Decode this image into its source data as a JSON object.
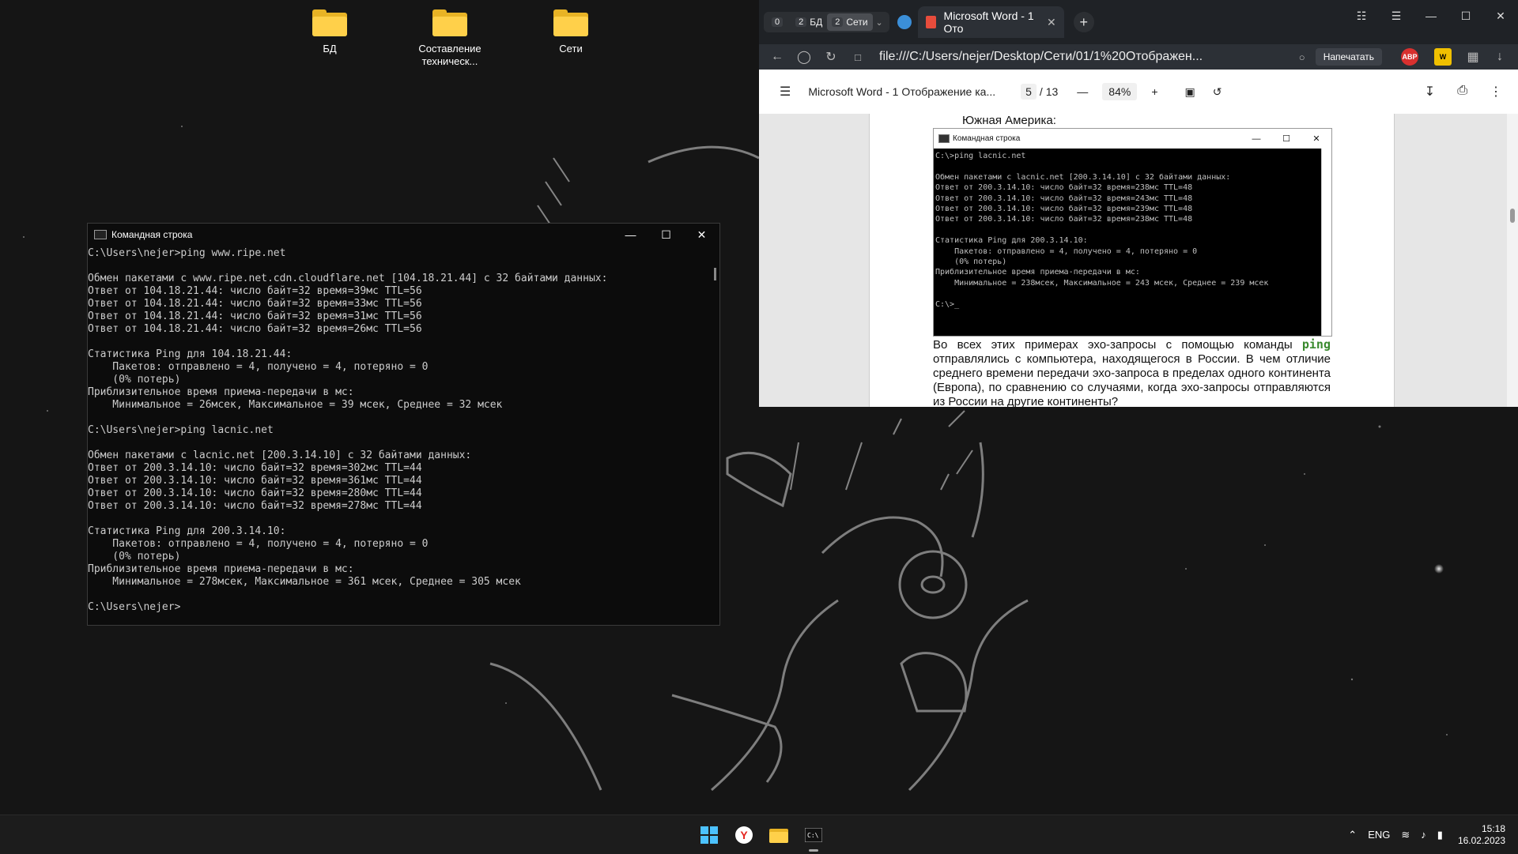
{
  "desktop": {
    "icons": [
      {
        "label": "БД"
      },
      {
        "label": "Составление техническ..."
      },
      {
        "label": "Сети"
      }
    ]
  },
  "cmd_window": {
    "title": "Командная строка",
    "lines": [
      "C:\\Users\\nejer>ping www.ripe.net",
      "",
      "Обмен пакетами с www.ripe.net.cdn.cloudflare.net [104.18.21.44] с 32 байтами данных:",
      "Ответ от 104.18.21.44: число байт=32 время=39мс TTL=56",
      "Ответ от 104.18.21.44: число байт=32 время=33мс TTL=56",
      "Ответ от 104.18.21.44: число байт=32 время=31мс TTL=56",
      "Ответ от 104.18.21.44: число байт=32 время=26мс TTL=56",
      "",
      "Статистика Ping для 104.18.21.44:",
      "    Пакетов: отправлено = 4, получено = 4, потеряно = 0",
      "    (0% потерь)",
      "Приблизительное время приема-передачи в мс:",
      "    Минимальное = 26мсек, Максимальное = 39 мсек, Среднее = 32 мсек",
      "",
      "C:\\Users\\nejer>ping lacnic.net",
      "",
      "Обмен пакетами с lacnic.net [200.3.14.10] с 32 байтами данных:",
      "Ответ от 200.3.14.10: число байт=32 время=302мс TTL=44",
      "Ответ от 200.3.14.10: число байт=32 время=361мс TTL=44",
      "Ответ от 200.3.14.10: число байт=32 время=280мс TTL=44",
      "Ответ от 200.3.14.10: число байт=32 время=278мс TTL=44",
      "",
      "Статистика Ping для 200.3.14.10:",
      "    Пакетов: отправлено = 4, получено = 4, потеряно = 0",
      "    (0% потерь)",
      "Приблизительное время приема-передачи в мс:",
      "    Минимальное = 278мсек, Максимальное = 361 мсек, Среднее = 305 мсек",
      "",
      "C:\\Users\\nejer>"
    ]
  },
  "browser": {
    "tab_groups": [
      {
        "count": "0",
        "label": ""
      },
      {
        "count": "2",
        "label": "БД"
      },
      {
        "count": "2",
        "label": "Сети"
      }
    ],
    "active_tab": "Microsoft Word - 1 Ото",
    "url": "file:///C:/Users/nejer/Desktop/Сети/01/1%20Отображен...",
    "print_button": "Напечатать",
    "extensions": [
      "ABP",
      "W"
    ],
    "pdf_toolbar": {
      "doc_title": "Microsoft Word - 1 Отображение ка...",
      "page_current": "5",
      "page_total": "/ 13",
      "zoom": "84%"
    },
    "pdf_page": {
      "heading": "Южная Америка:",
      "screenshot_title": "Командная строка",
      "screenshot_lines": [
        "C:\\>ping lacnic.net",
        "",
        "Обмен пакетами с lacnic.net [200.3.14.10] с 32 байтами данных:",
        "Ответ от 200.3.14.10: число байт=32 время=238мс TTL=48",
        "Ответ от 200.3.14.10: число байт=32 время=243мс TTL=48",
        "Ответ от 200.3.14.10: число байт=32 время=239мс TTL=48",
        "Ответ от 200.3.14.10: число байт=32 время=238мс TTL=48",
        "",
        "Статистика Ping для 200.3.14.10:",
        "    Пакетов: отправлено = 4, получено = 4, потеряно = 0",
        "    (0% потерь)",
        "Приблизительное время приема-передачи в мс:",
        "    Минимальное = 238мсек, Максимальное = 243 мсек, Среднее = 239 мсек",
        "",
        "C:\\>_"
      ],
      "para_before": "Во всех этих примерах эхо-запросы с помощью команды ",
      "para_code": "ping",
      "para_after": " отправлялись с компьютера, находящегося в России. В чем отличие среднего времени передачи эхо-запроса в пределах одного континента (Европа), по сравнению со случаями, когда эхо-запросы отправляются из России на другие континенты?"
    }
  },
  "taskbar": {
    "language": "ENG",
    "time": "15:18",
    "date": "16.02.2023"
  },
  "colors": {
    "folder": "#ffd04a",
    "ping_code": "#3a8a2e",
    "taskbar": "#1c1c1c"
  }
}
